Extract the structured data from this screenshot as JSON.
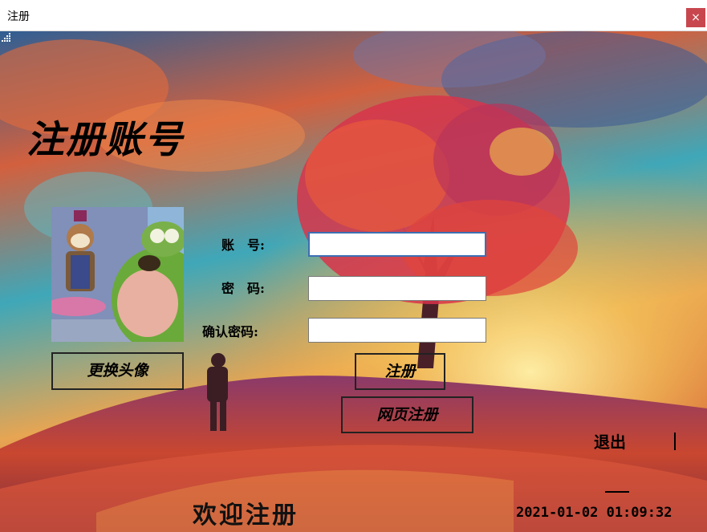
{
  "window": {
    "title": "注册",
    "close_label": "×"
  },
  "heading": "注册账号",
  "form": {
    "account_label": "账　号:",
    "account_value": "",
    "password_label": "密　码:",
    "password_value": "",
    "confirm_label": "确认密码:",
    "confirm_value": ""
  },
  "buttons": {
    "change_avatar": "更换头像",
    "register": "注册",
    "web_register": "网页注册",
    "exit": "退出"
  },
  "footer": {
    "welcome": "欢迎注册",
    "datetime": "2021-01-02 01:09:32"
  },
  "colors": {
    "close_button": "#c8474e",
    "focused_border": "#3c6fb4"
  }
}
